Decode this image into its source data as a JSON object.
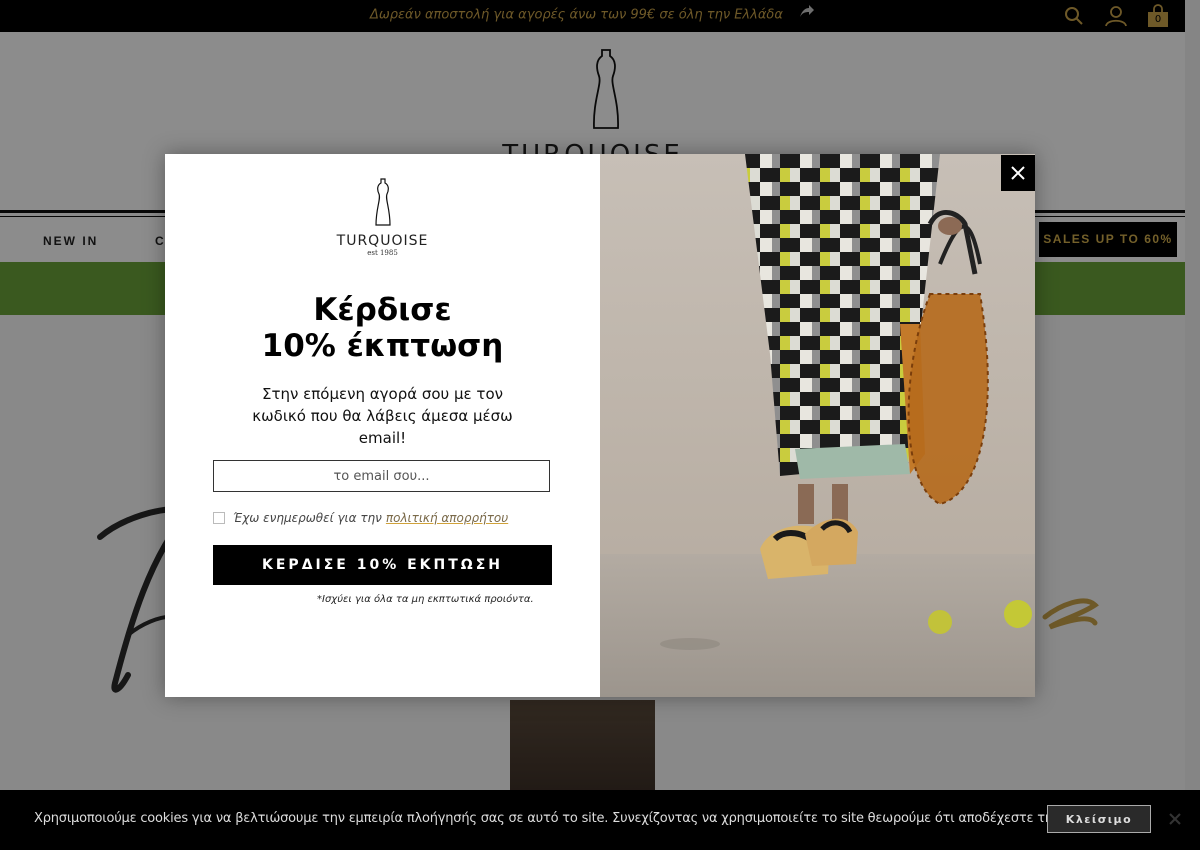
{
  "topbar": {
    "promo_text": "Δωρεάν αποστολή για αγορές άνω των 99€ σε όλη την Ελλάδα",
    "cart_count": "0",
    "icons": [
      "search-icon",
      "user-icon",
      "cart-icon"
    ]
  },
  "header": {
    "brand": "TURQUOISE"
  },
  "nav": {
    "new_in": "NEW IN",
    "partial_item": "C",
    "sales": "SALES UP TO 60%"
  },
  "modal": {
    "logo_wordmark": "TURQUOISE",
    "logo_est": "est 1985",
    "headline_line1": "Κέρδισε",
    "headline_line2": "10% έκπτωση",
    "subtext": "Στην επόμενη αγορά σου με τον κωδικό που θα λάβεις άμεσα μέσω email!",
    "email_placeholder": "το email σου...",
    "consent_text": "Έχω ενημερωθεί για την",
    "consent_link": "πολιτική απορρήτου",
    "cta_label": "ΚΕΡΔΙΣΕ 10% ΕΚΠΤΩΣΗ",
    "disclaimer": "*Ισχύει για όλα τα μη εκπτωτικά προιόντα."
  },
  "cookie": {
    "message": "Χρησιμοποιούμε cookies για να βελτιώσουμε την εμπειρία πλοήγησής σας σε αυτό το site. Συνεχίζοντας να χρησιμοποιείτε το site θεωρούμε ότι αποδέχεστε τη χρήση cookies.",
    "accept_label": "Κλείσιμο"
  },
  "colors": {
    "accent_gold": "#c9a24a",
    "promo_green": "#6aa23a",
    "black": "#000000"
  }
}
